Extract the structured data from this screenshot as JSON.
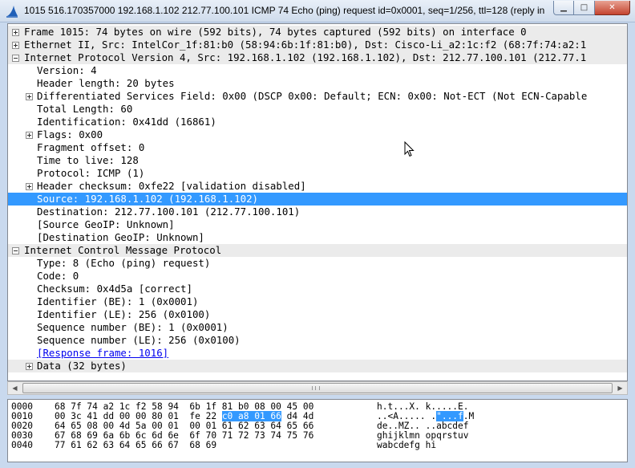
{
  "window": {
    "title": "1015 516.170357000 192.168.1.102 212.77.100.101 ICMP 74 Echo (ping) request  id=0x0001, seq=1/256, ttl=128 (reply in...",
    "minimize_glyph": "▁",
    "maximize_glyph": "□",
    "close_glyph": "✕"
  },
  "tree": [
    {
      "indent": 0,
      "expander": "plus",
      "section": true,
      "text": "Frame 1015: 74 bytes on wire (592 bits), 74 bytes captured (592 bits) on interface 0"
    },
    {
      "indent": 0,
      "expander": "plus",
      "section": true,
      "text": "Ethernet II, Src: IntelCor_1f:81:b0 (58:94:6b:1f:81:b0), Dst: Cisco-Li_a2:1c:f2 (68:7f:74:a2:1"
    },
    {
      "indent": 0,
      "expander": "minus",
      "section": true,
      "text": "Internet Protocol Version 4, Src: 192.168.1.102 (192.168.1.102), Dst: 212.77.100.101 (212.77.1"
    },
    {
      "indent": 1,
      "expander": "",
      "text": "Version: 4"
    },
    {
      "indent": 1,
      "expander": "",
      "text": "Header length: 20 bytes"
    },
    {
      "indent": 1,
      "expander": "plus",
      "text": "Differentiated Services Field: 0x00 (DSCP 0x00: Default; ECN: 0x00: Not-ECT (Not ECN-Capable"
    },
    {
      "indent": 1,
      "expander": "",
      "text": "Total Length: 60"
    },
    {
      "indent": 1,
      "expander": "",
      "text": "Identification: 0x41dd (16861)"
    },
    {
      "indent": 1,
      "expander": "plus",
      "text": "Flags: 0x00"
    },
    {
      "indent": 1,
      "expander": "",
      "text": "Fragment offset: 0"
    },
    {
      "indent": 1,
      "expander": "",
      "text": "Time to live: 128"
    },
    {
      "indent": 1,
      "expander": "",
      "text": "Protocol: ICMP (1)"
    },
    {
      "indent": 1,
      "expander": "plus",
      "text": "Header checksum: 0xfe22 [validation disabled]"
    },
    {
      "indent": 1,
      "expander": "",
      "selected": true,
      "text": "Source: 192.168.1.102 (192.168.1.102)"
    },
    {
      "indent": 1,
      "expander": "",
      "text": "Destination: 212.77.100.101 (212.77.100.101)"
    },
    {
      "indent": 1,
      "expander": "",
      "text": "[Source GeoIP: Unknown]"
    },
    {
      "indent": 1,
      "expander": "",
      "text": "[Destination GeoIP: Unknown]"
    },
    {
      "indent": 0,
      "expander": "minus",
      "section": true,
      "text": "Internet Control Message Protocol"
    },
    {
      "indent": 1,
      "expander": "",
      "text": "Type: 8 (Echo (ping) request)"
    },
    {
      "indent": 1,
      "expander": "",
      "text": "Code: 0"
    },
    {
      "indent": 1,
      "expander": "",
      "text": "Checksum: 0x4d5a [correct]"
    },
    {
      "indent": 1,
      "expander": "",
      "text": "Identifier (BE): 1 (0x0001)"
    },
    {
      "indent": 1,
      "expander": "",
      "text": "Identifier (LE): 256 (0x0100)"
    },
    {
      "indent": 1,
      "expander": "",
      "text": "Sequence number (BE): 1 (0x0001)"
    },
    {
      "indent": 1,
      "expander": "",
      "text": "Sequence number (LE): 256 (0x0100)"
    },
    {
      "indent": 1,
      "expander": "",
      "link": true,
      "text": "[Response frame: 1016]"
    },
    {
      "indent": 1,
      "expander": "plus",
      "section": true,
      "text": "Data (32 bytes)"
    }
  ],
  "hex": [
    {
      "offset": "0000",
      "bytes": [
        [
          "68 7f 74 a2 1c f2 58 94  6b 1f 81 b0 08 00 45 00",
          ""
        ]
      ],
      "ascii": [
        [
          "h.t...X. k.....E.",
          ""
        ]
      ]
    },
    {
      "offset": "0010",
      "bytes": [
        [
          "00 3c 41 dd 00 00 80 01  fe 22 ",
          ""
        ],
        [
          "c0 a8 01 66",
          "hl"
        ],
        [
          " d4 4d",
          ""
        ]
      ],
      "ascii": [
        [
          "..<A..... .",
          ""
        ],
        [
          "\"...f",
          "hl"
        ],
        [
          ".M",
          ""
        ]
      ]
    },
    {
      "offset": "0020",
      "bytes": [
        [
          "64 65 08 00 4d 5a 00 01  00 01 61 62 63 64 65 66",
          ""
        ]
      ],
      "ascii": [
        [
          "de..MZ.. ..abcdef",
          ""
        ]
      ]
    },
    {
      "offset": "0030",
      "bytes": [
        [
          "67 68 69 6a 6b 6c 6d 6e  6f 70 71 72 73 74 75 76",
          ""
        ]
      ],
      "ascii": [
        [
          "ghijklmn opqrstuv",
          ""
        ]
      ]
    },
    {
      "offset": "0040",
      "bytes": [
        [
          "77 61 62 63 64 65 66 67  68 69",
          ""
        ]
      ],
      "ascii": [
        [
          "wabcdefg hi",
          ""
        ]
      ]
    }
  ],
  "colors": {
    "selection": "#3399ff",
    "section_row": "#ebebeb",
    "link": "#0000ee"
  }
}
